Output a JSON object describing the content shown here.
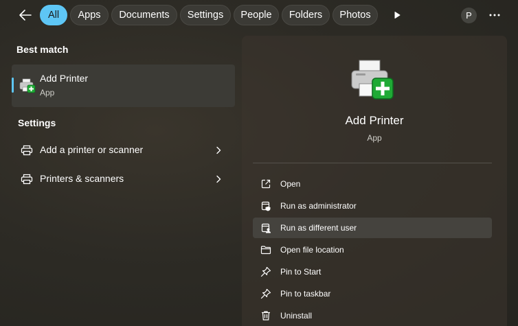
{
  "tabs": [
    {
      "label": "All",
      "active": true
    },
    {
      "label": "Apps",
      "active": false
    },
    {
      "label": "Documents",
      "active": false
    },
    {
      "label": "Settings",
      "active": false
    },
    {
      "label": "People",
      "active": false
    },
    {
      "label": "Folders",
      "active": false
    },
    {
      "label": "Photos",
      "active": false
    }
  ],
  "user": {
    "avatar_letter": "P"
  },
  "colors": {
    "accent": "#5ec6f5",
    "panel": "#3c3b36",
    "green_plus": "#1faa35"
  },
  "best_match": {
    "heading": "Best match",
    "item": {
      "title": "Add Printer",
      "subtitle": "App",
      "icon": "add-printer-icon"
    }
  },
  "settings": {
    "heading": "Settings",
    "items": [
      {
        "label": "Add a printer or scanner",
        "icon": "printer-icon"
      },
      {
        "label": "Printers & scanners",
        "icon": "printer-icon"
      }
    ]
  },
  "detail": {
    "title": "Add Printer",
    "subtitle": "App",
    "actions": [
      {
        "label": "Open",
        "icon": "open-external-icon"
      },
      {
        "label": "Run as administrator",
        "icon": "shield-icon"
      },
      {
        "label": "Run as different user",
        "icon": "user-switch-icon"
      },
      {
        "label": "Open file location",
        "icon": "folder-icon"
      },
      {
        "label": "Pin to Start",
        "icon": "pin-icon"
      },
      {
        "label": "Pin to taskbar",
        "icon": "pin-icon"
      },
      {
        "label": "Uninstall",
        "icon": "trash-icon"
      }
    ]
  }
}
